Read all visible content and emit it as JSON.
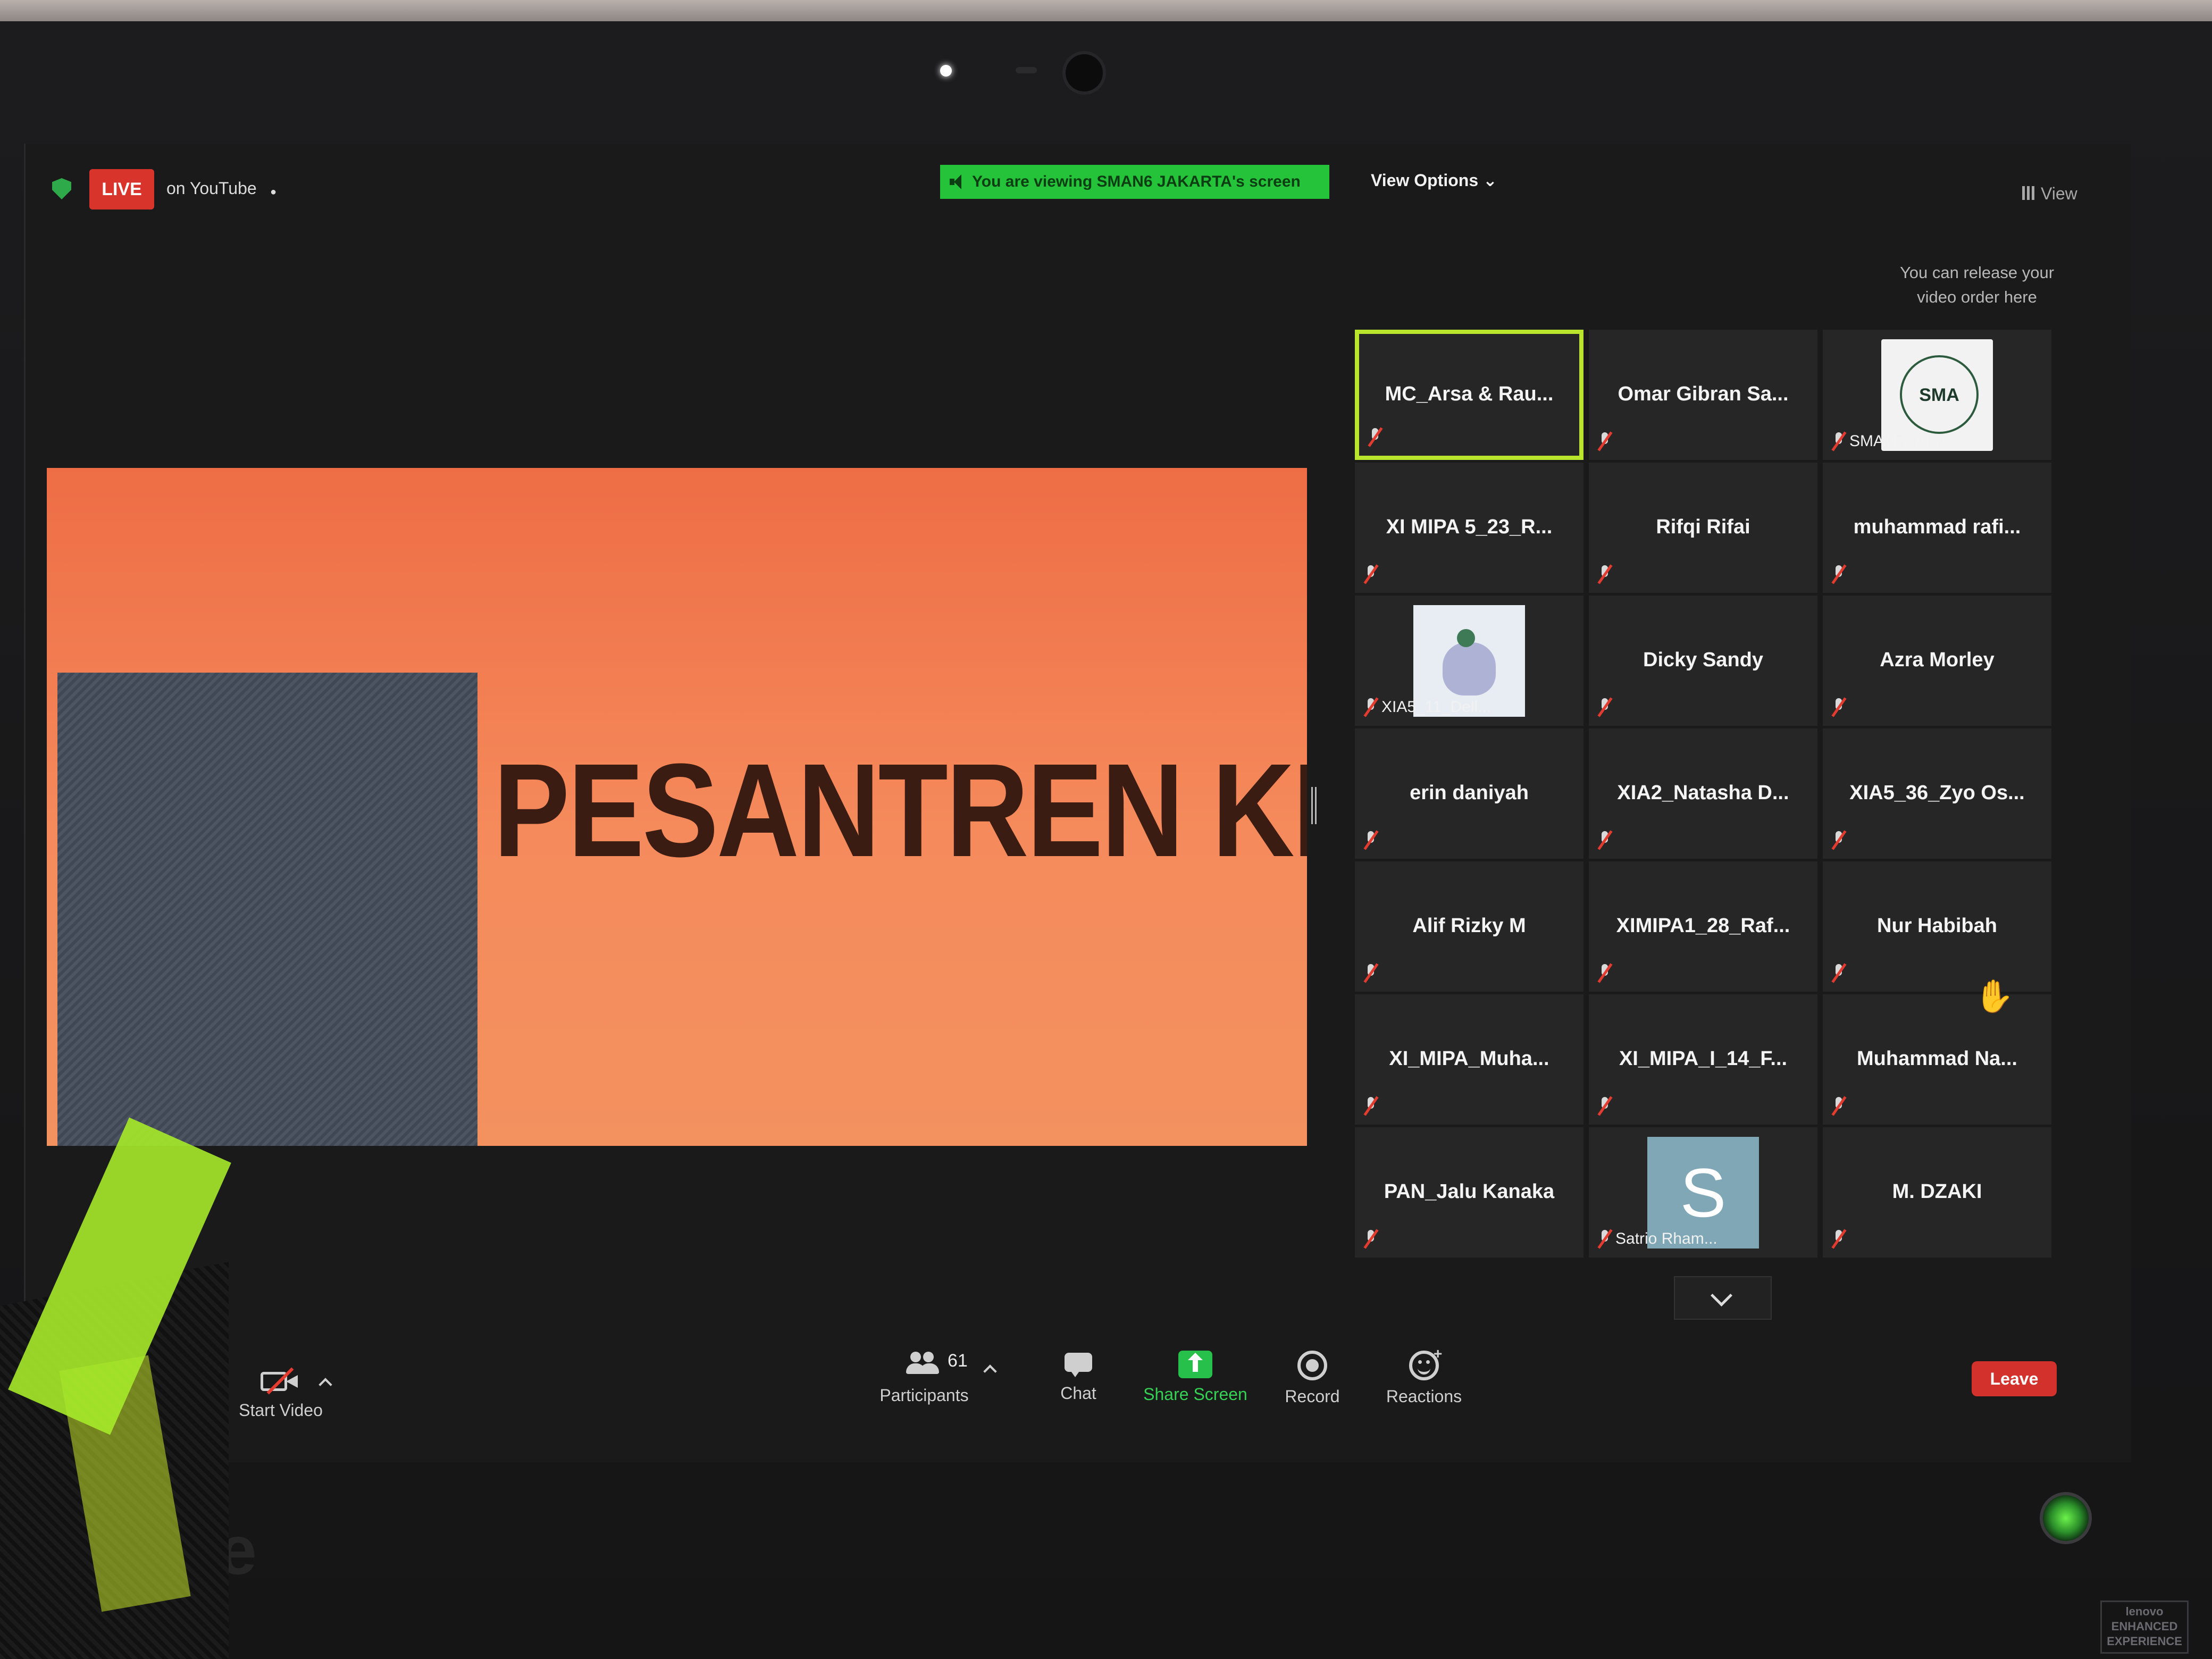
{
  "topbar": {
    "live_label": "LIVE",
    "live_destination": "on YouTube",
    "viewing_banner": "You are viewing SMAN6 JAKARTA's screen",
    "view_options": "View Options",
    "view_label": "View",
    "release_hint": "You can release your video order here"
  },
  "slide": {
    "title": "PESANTREN KILAT"
  },
  "gallery": {
    "tiles": [
      {
        "name": "MC_Arsa & Rau...",
        "active": true
      },
      {
        "name": "Omar Gibran Sa..."
      },
      {
        "name": "SMAN6 JAKA...",
        "avatar": "SMA"
      },
      {
        "name": "XI MIPA 5_23_R..."
      },
      {
        "name": "Rifqi Rifai"
      },
      {
        "name": "muhammad rafi..."
      },
      {
        "name": "XIA5_11_Dell...",
        "avatar": "cat"
      },
      {
        "name": "Dicky Sandy"
      },
      {
        "name": "Azra Morley"
      },
      {
        "name": "erin daniyah"
      },
      {
        "name": "XIA2_Natasha D..."
      },
      {
        "name": "XIA5_36_Zyo Os..."
      },
      {
        "name": "Alif Rizky M"
      },
      {
        "name": "XIMIPA1_28_Raf..."
      },
      {
        "name": "Nur Habibah"
      },
      {
        "name": "XI_MIPA_Muha..."
      },
      {
        "name": "XI_MIPA_I_14_F..."
      },
      {
        "name": "Muhammad Na..."
      },
      {
        "name": "PAN_Jalu Kanaka"
      },
      {
        "name": "Satrio Rham...",
        "avatar": "S"
      },
      {
        "name": "M. DZAKI"
      }
    ]
  },
  "toolbar": {
    "start_video": "Start Video",
    "participants_label": "Participants",
    "participants_count": "61",
    "chat": "Chat",
    "share_screen": "Share Screen",
    "record": "Record",
    "reactions": "Reactions",
    "leave": "Leave"
  },
  "hardware": {
    "monitor_brand": "re",
    "badge": "lenovo ENHANCED EXPERIENCE"
  },
  "colors": {
    "live_red": "#d9342b",
    "share_green": "#26c04a",
    "banner_green": "#24c33a",
    "active_speaker": "#b9e52c",
    "slide_orange": "#f58b5c",
    "leave_red": "#d2312c"
  }
}
